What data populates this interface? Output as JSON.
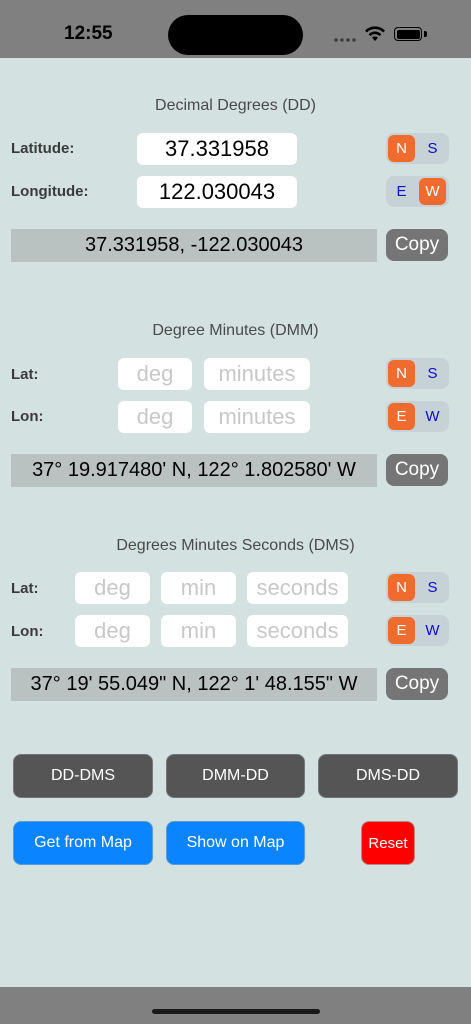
{
  "status": {
    "time": "12:55"
  },
  "dd": {
    "title": "Decimal Degrees (DD)",
    "lat_label": "Latitude:",
    "lon_label": "Longitude:",
    "lat_value": "37.331958",
    "lon_value": "122.030043",
    "lat_dir": {
      "options": [
        "N",
        "S"
      ],
      "selected": "N"
    },
    "lon_dir": {
      "options": [
        "E",
        "W"
      ],
      "selected": "W"
    },
    "result": "37.331958, -122.030043",
    "copy_label": "Copy"
  },
  "dmm": {
    "title": "Degree Minutes (DMM)",
    "lat_label": "Lat:",
    "lon_label": "Lon:",
    "deg_placeholder": "deg",
    "min_placeholder": "minutes",
    "lat_dir": {
      "options": [
        "N",
        "S"
      ],
      "selected": "N"
    },
    "lon_dir": {
      "options": [
        "E",
        "W"
      ],
      "selected": "E"
    },
    "result": "37° 19.917480' N, 122° 1.802580' W",
    "copy_label": "Copy"
  },
  "dms": {
    "title": "Degrees Minutes Seconds (DMS)",
    "lat_label": "Lat:",
    "lon_label": "Lon:",
    "deg_placeholder": "deg",
    "min_placeholder": "min",
    "sec_placeholder": "seconds",
    "lat_dir": {
      "options": [
        "N",
        "S"
      ],
      "selected": "N"
    },
    "lon_dir": {
      "options": [
        "E",
        "W"
      ],
      "selected": "E"
    },
    "result": "37° 19' 55.049\"  N, 122° 1' 48.155\" W",
    "copy_label": "Copy"
  },
  "actions": {
    "dd_dms": "DD-DMS",
    "dmm_dd": "DMM-DD",
    "dms_dd": "DMS-DD",
    "get_from_map": "Get from Map",
    "show_on_map": "Show on Map",
    "reset": "Reset"
  },
  "colors": {
    "background": "#d3e2e0",
    "selected_segment": "#f06b2e",
    "primary_blue": "#0a84ff",
    "reset_red": "#ff0000"
  }
}
